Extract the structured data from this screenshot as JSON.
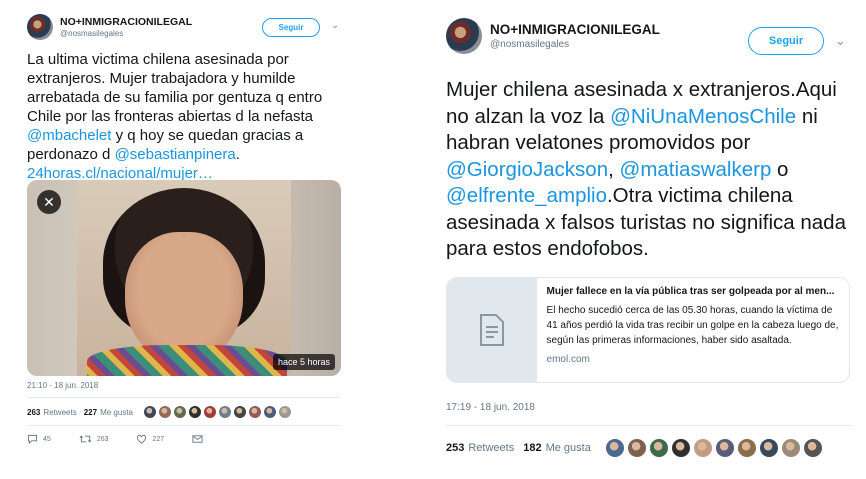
{
  "left_tweet": {
    "display_name": "NO+INMIGRACIONILEGAL",
    "handle": "@nosmasilegales",
    "follow_label": "Seguir",
    "caret": "⌄",
    "text_parts": [
      "La ultima victima chilena asesinada por extranjeros. Mujer trabajadora y humilde arrebatada de su familia por gentuza q entro Chile por las fronteras abiertas d la nefasta ",
      "@mbachelet",
      " y q hoy se quedan gracias a perdonazo d ",
      "@sebastianpinera",
      ". ",
      "24horas.cl/nacional/mujer…"
    ],
    "media_close": "✕",
    "media_badge": "hace 5 horas",
    "timestamp": "21:10 - 18 jun. 2018",
    "retweets_count": "263",
    "retweets_label": "Retweets",
    "likes_count": "227",
    "likes_label": "Me gusta",
    "actions": {
      "replies": "45",
      "retweets": "263",
      "likes": "227"
    },
    "liker_colors": [
      "#3b4a5a",
      "#8a6b5c",
      "#5d6d4e",
      "#2e2e2e",
      "#a33b3b",
      "#6e7f91",
      "#444",
      "#8e5a5a",
      "#4b5d7a",
      "#999"
    ]
  },
  "right_tweet": {
    "display_name": "NO+INMIGRACIONILEGAL",
    "handle": "@nosmasilegales",
    "follow_label": "Seguir",
    "caret": "⌄",
    "text_parts": [
      "Mujer chilena asesinada x extranjeros.Aqui no alzan la voz la ",
      "@NiUnaMenosChile",
      " ni habran velatones promovidos por ",
      "@GiorgioJackson",
      ", ",
      "@matiaswalkerp",
      " o ",
      "@elfrente_amplio",
      ".Otra victima chilena asesinada x falsos turistas no significa nada para estos endofobos."
    ],
    "card": {
      "title": "Mujer fallece en la vía pública tras ser golpeada por al men...",
      "description": "El hecho sucedió cerca de las 05.30 horas, cuando la víctima de 41 años perdió la vida tras recibir un golpe en la cabeza luego de, según las primeras informaciones, haber sido asaltada.",
      "domain": "emol.com"
    },
    "timestamp": "17:19 - 18 jun. 2018",
    "retweets_count": "253",
    "retweets_label": "Retweets",
    "likes_count": "182",
    "likes_label": "Me gusta",
    "liker_colors": [
      "#4b6a8f",
      "#7d6150",
      "#3a6b4f",
      "#2f2f2f",
      "#c59a83",
      "#5b5b7a",
      "#8c6d4a",
      "#37495e",
      "#9a8a7a",
      "#555"
    ]
  }
}
